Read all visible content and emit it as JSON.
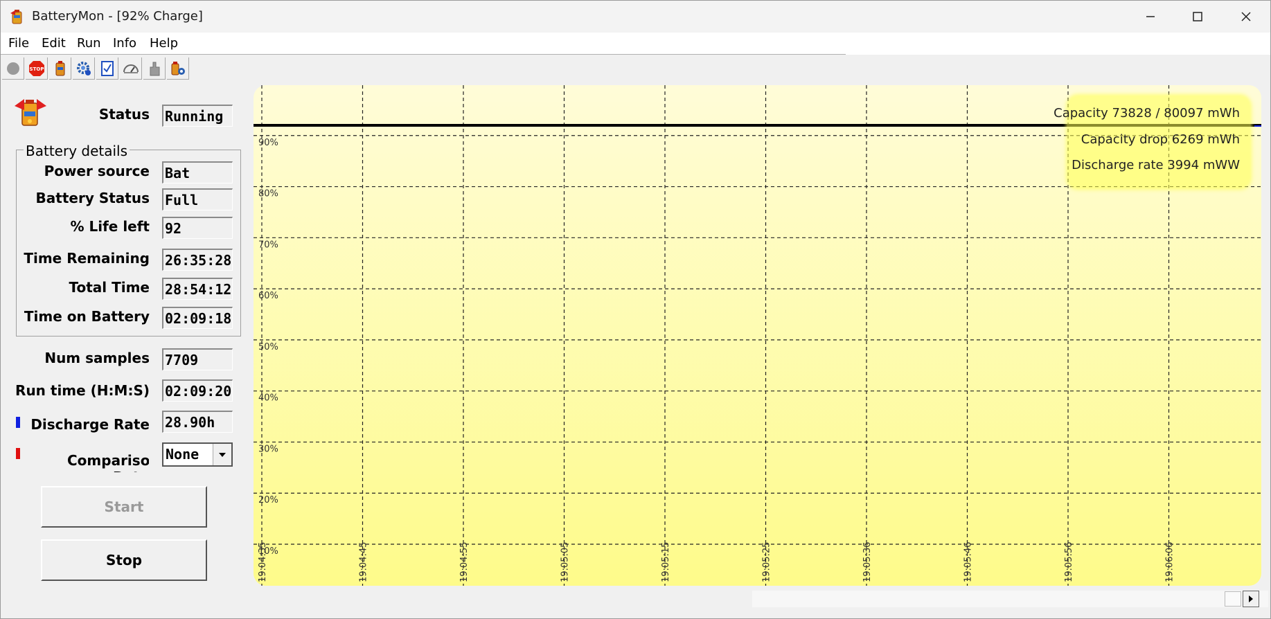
{
  "window": {
    "title": "BatteryMon - [92% Charge]"
  },
  "menu": [
    "File",
    "Edit",
    "Run",
    "Info",
    "Help"
  ],
  "toolbar": {
    "icons": [
      "record-icon",
      "stop-sign-icon",
      "battery-icon",
      "settings-gear-icon",
      "checklist-icon",
      "gauge-icon",
      "hand-pointer-icon",
      "battery-settings-icon"
    ]
  },
  "status": {
    "label": "Status",
    "value": "Running"
  },
  "battery_details": {
    "title": "Battery details",
    "rows": [
      {
        "label": "Power source",
        "value": "Bat"
      },
      {
        "label": "Battery Status",
        "value": "Full"
      },
      {
        "label": "% Life left",
        "value": "92"
      },
      {
        "label": "Time Remaining",
        "value": "26:35:28"
      },
      {
        "label": "Total Time",
        "value": "28:54:12"
      },
      {
        "label": "Time on Battery",
        "value": "02:09:18"
      }
    ]
  },
  "stats": {
    "num_samples_label": "Num samples",
    "num_samples_value": "7709",
    "run_time_label": "Run time (H:M:S)",
    "run_time_value": "02:09:20",
    "discharge_label": "Discharge Rate",
    "discharge_value": "28.90h",
    "comparison_label": "Comparison Rate",
    "comparison_value": "None"
  },
  "colors": {
    "discharge_marker": "#1020e0",
    "comparison_marker": "#e01010",
    "chart_bg_top": "#fffcd8",
    "chart_bg_bottom": "#fefb8a"
  },
  "buttons": {
    "start": "Start",
    "stop": "Stop"
  },
  "info_box": {
    "capacity": "Capacity 73828 / 80097 mWh",
    "capacity_drop": "Capacity drop 6269 mWh",
    "discharge_rate": "Discharge rate 3994 mWW"
  },
  "chart_data": {
    "type": "line",
    "y_ticks": [
      "90%",
      "80%",
      "70%",
      "60%",
      "50%",
      "40%",
      "30%",
      "20%",
      "10%"
    ],
    "x_ticks": [
      "19:04:35",
      "19:04:45",
      "19:04:55",
      "19:05:05",
      "19:05:15",
      "19:05:25",
      "19:05:36",
      "19:05:46",
      "19:05:56",
      "19:06:06"
    ],
    "grid": true,
    "series": [
      {
        "color": "#000000",
        "values": [
          92,
          92,
          92,
          92,
          92,
          92,
          92,
          92,
          92,
          92
        ]
      }
    ],
    "ylim": [
      10,
      100
    ]
  }
}
